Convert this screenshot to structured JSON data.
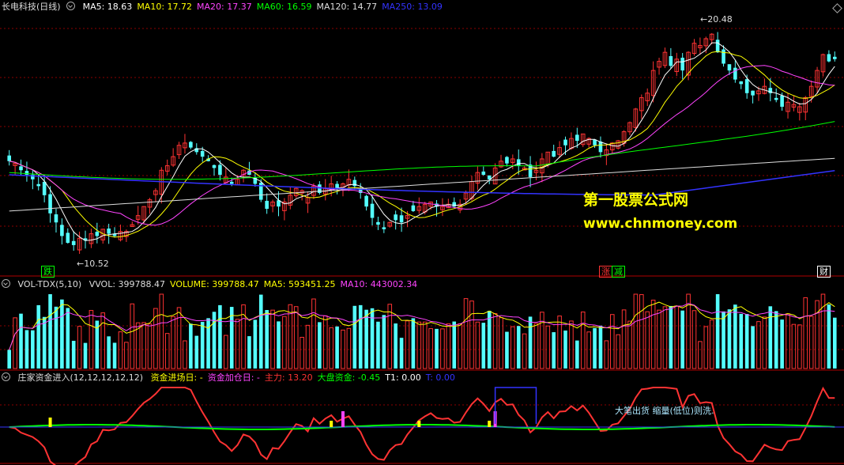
{
  "main_panel": {
    "title": "长电科技(日线)",
    "ma_labels": [
      {
        "text": "MA5: 18.63",
        "color": "#ffffff"
      },
      {
        "text": "MA10: 17.72",
        "color": "#ffff00"
      },
      {
        "text": "MA20: 17.37",
        "color": "#ff44ff"
      },
      {
        "text": "MA60: 16.59",
        "color": "#00ff00"
      },
      {
        "text": "MA120: 14.77",
        "color": "#dddddd"
      },
      {
        "text": "MA250: 13.09",
        "color": "#3333ff"
      }
    ],
    "high_label": "20.48",
    "low_label": "10.52",
    "markers": [
      {
        "text": "跌",
        "color": "#00ff00"
      },
      {
        "text": "涨",
        "color": "#ff3333"
      },
      {
        "text": "减",
        "color": "#00ff00"
      },
      {
        "text": "财",
        "color": "#ffffff"
      }
    ],
    "watermark_cn": "第一股票公式网",
    "watermark_url": "www.chnmoney.com"
  },
  "volume_panel": {
    "title": "VOL-TDX(5,10)",
    "labels": [
      {
        "text": "VVOL: 399788.47",
        "color": "#dddddd"
      },
      {
        "text": "VOLUME: 399788.47",
        "color": "#ffff00"
      },
      {
        "text": "MA5: 593451.25",
        "color": "#ffff00"
      },
      {
        "text": "MA10: 443002.34",
        "color": "#ff44ff"
      }
    ]
  },
  "indicator_panel": {
    "title": "庄家资金进入(12,12,12,12,12)",
    "labels": [
      {
        "text": "资金进场日: -",
        "color": "#ffff00"
      },
      {
        "text": "资金加仓日: -",
        "color": "#ff44ff"
      },
      {
        "text": "主力: 13.20",
        "color": "#ff3333"
      },
      {
        "text": "大盘资金: -0.45",
        "color": "#00ff00"
      },
      {
        "text": "T1: 0.00",
        "color": "#ffffff"
      },
      {
        "text": "T: 0.00",
        "color": "#3333ff"
      }
    ],
    "annotation": "大笔出货 缩量(低位)则洗."
  },
  "colors": {
    "up": "#ff3333",
    "down": "#54ffff",
    "grid": "#8b0000",
    "ma5": "#ffffff",
    "ma10": "#ffff00",
    "ma20": "#ff44ff",
    "ma60": "#00ff00",
    "ma120": "#dddddd",
    "ma250": "#3333ff"
  },
  "chart_data": {
    "type": "candlestick",
    "price_range": [
      10.52,
      20.48
    ],
    "series": [
      {
        "name": "MA5",
        "last": 18.63
      },
      {
        "name": "MA10",
        "last": 17.72
      },
      {
        "name": "MA20",
        "last": 17.37
      },
      {
        "name": "MA60",
        "last": 16.59
      },
      {
        "name": "MA120",
        "last": 14.77
      },
      {
        "name": "MA250",
        "last": 13.09
      }
    ],
    "close": [
      14.6,
      14.5,
      14.2,
      14.0,
      13.8,
      13.5,
      13.1,
      12.3,
      11.9,
      11.3,
      11.0,
      10.9,
      11.2,
      11.1,
      11.4,
      11.3,
      11.6,
      11.4,
      11.3,
      11.5,
      11.5,
      11.8,
      12.2,
      12.6,
      12.9,
      13.3,
      14.2,
      14.4,
      14.8,
      15.3,
      15.4,
      15.2,
      15.0,
      14.8,
      14.6,
      14.3,
      14.0,
      13.9,
      13.6,
      13.8,
      14.2,
      14.0,
      13.6,
      12.9,
      12.5,
      12.8,
      12.6,
      12.8,
      13.1,
      13.4,
      13.3,
      13.0,
      13.5,
      13.2,
      13.4,
      13.6,
      13.4,
      13.6,
      13.8,
      13.5,
      13.2,
      12.6,
      12.1,
      11.8,
      11.6,
      11.9,
      12.0,
      11.9,
      12.2,
      12.4,
      12.6,
      12.7,
      12.8,
      12.6,
      12.6,
      12.7,
      12.6,
      12.7,
      13.2,
      13.7,
      14.1,
      14.0,
      13.8,
      14.3,
      14.6,
      14.5,
      14.7,
      14.4,
      14.3,
      13.9,
      14.2,
      14.7,
      15.0,
      14.8,
      15.2,
      15.3,
      15.6,
      15.5,
      15.8,
      15.6,
      15.3,
      15.0,
      15.1,
      15.4,
      15.5,
      15.9,
      16.3,
      16.9,
      17.4,
      17.6,
      18.6,
      19.0,
      19.4,
      18.8,
      19.1,
      18.6,
      19.4,
      19.8,
      19.7,
      20.0,
      20.2,
      19.4,
      18.9,
      18.6,
      18.2,
      18.0,
      17.6,
      17.5,
      17.7,
      17.9,
      17.6,
      17.3,
      17.0,
      17.2,
      17.1,
      17.0,
      17.4,
      17.9,
      18.6,
      19.3,
      19.0,
      19.1
    ],
    "volume_ma5_last": 593451.25,
    "volume_ma10_last": 443002.34,
    "volume_last": 399788.47,
    "main_force_last": 13.2,
    "market_fund_last": -0.45,
    "t1_last": 0.0,
    "t_last": 0.0
  }
}
